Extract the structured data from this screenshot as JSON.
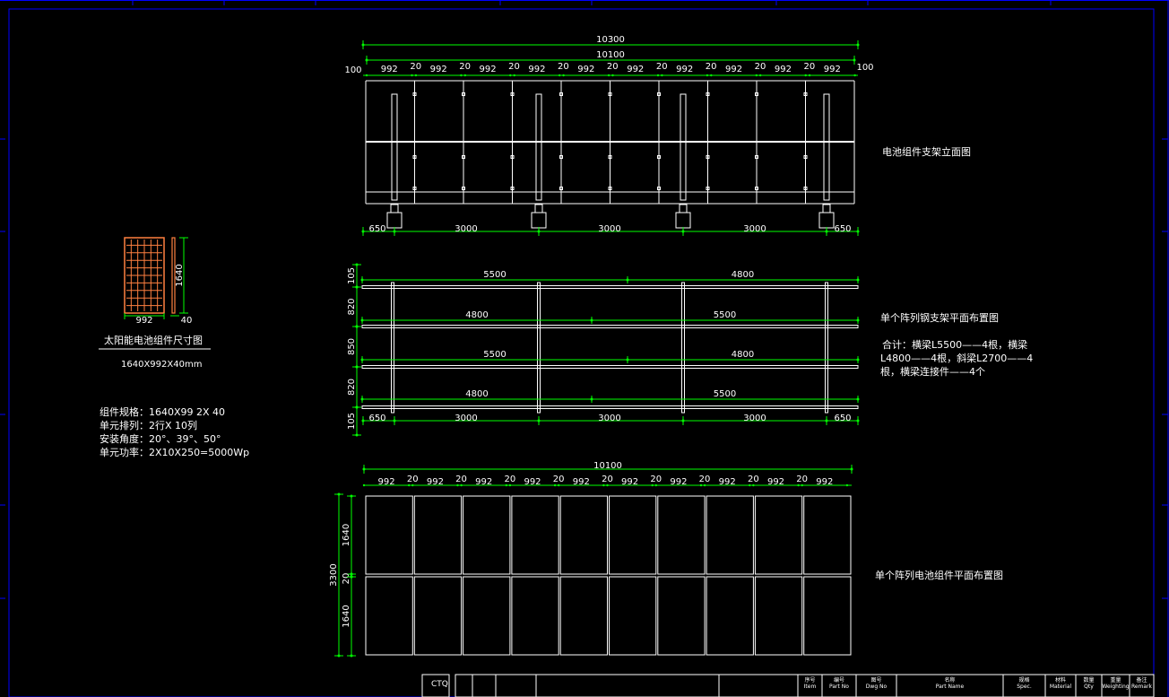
{
  "elevation": {
    "title": "电池组件支架立面图",
    "overall": "10300",
    "inner": "10100",
    "edge": "100",
    "panel": "992",
    "gap": "20",
    "span_edge": "650",
    "span": "3000"
  },
  "plan": {
    "title": "单个阵列钢支架平面布置图",
    "note_line1": "合计：横梁L5500——4根，横梁",
    "note_line2": "L4800——4根，斜梁L2700——4",
    "note_line3": "根，横梁连接件——4个",
    "row_dims": [
      "105",
      "820",
      "850",
      "820",
      "105"
    ],
    "beam_a": "5500",
    "beam_b": "4800",
    "span_edge": "650",
    "span": "3000"
  },
  "layout": {
    "title": "单个阵列电池组件平面布置图",
    "overall": "10100",
    "panel": "992",
    "gap": "20",
    "height_total": "3300",
    "height_panel": "1640",
    "height_gap": "20"
  },
  "module": {
    "caption": "太阳能电池组件尺寸图",
    "size": "1640X992X40mm",
    "width": "992",
    "height": "1640",
    "thickness": "40",
    "spec1": "组件规格：1640X99 2X 40",
    "spec2": "单元排列：2行X 10列",
    "spec3": "安装角度：20°、39°、50°",
    "spec4": "单元功率：2X10X250=5000Wp"
  },
  "title_block": {
    "ctq": "CTQ",
    "cols": [
      {
        "cn": "序号",
        "en": "Item"
      },
      {
        "cn": "编号",
        "en": "Part No"
      },
      {
        "cn": "图号",
        "en": "Dwg No"
      },
      {
        "cn": "名称",
        "en": "Part Name"
      },
      {
        "cn": "规格",
        "en": "Spec."
      },
      {
        "cn": "材料",
        "en": "Material"
      },
      {
        "cn": "数量",
        "en": "Qty"
      },
      {
        "cn": "重量",
        "en": "Weighting"
      },
      {
        "cn": "备注",
        "en": "Remark"
      }
    ]
  },
  "colors": {
    "background": "#000000",
    "line": "#ffffff",
    "dimension": "#00ff00",
    "border": "#0000ff",
    "module_outline": "#ff8040"
  }
}
